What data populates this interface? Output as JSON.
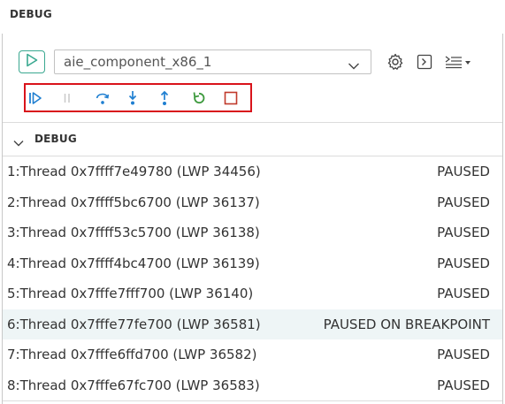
{
  "view": {
    "title": "DEBUG"
  },
  "launch": {
    "config_value": "aie_component_x86_1",
    "run_icon": "play-icon",
    "chevron_icon": "chevron-down-icon",
    "settings_icon": "gear-icon",
    "console_icon": "terminal-icon",
    "more_icon": "list-dropdown-icon"
  },
  "debug_toolbar": {
    "buttons": [
      {
        "name": "continue-icon",
        "enabled": true
      },
      {
        "name": "pause-icon",
        "enabled": false
      },
      {
        "name": "step-over-icon",
        "enabled": true
      },
      {
        "name": "step-into-icon",
        "enabled": true
      },
      {
        "name": "step-out-icon",
        "enabled": true
      },
      {
        "name": "restart-icon",
        "enabled": true
      },
      {
        "name": "stop-icon",
        "enabled": true
      }
    ],
    "highlight_color": "#d9131b"
  },
  "section": {
    "title": "DEBUG"
  },
  "threads": [
    {
      "name": "1:Thread 0x7ffff7e49780 (LWP 34456)",
      "status": "PAUSED"
    },
    {
      "name": "2:Thread 0x7ffff5bc6700 (LWP 36137)",
      "status": "PAUSED"
    },
    {
      "name": "3:Thread 0x7ffff53c5700 (LWP 36138)",
      "status": "PAUSED"
    },
    {
      "name": "4:Thread 0x7ffff4bc4700 (LWP 36139)",
      "status": "PAUSED"
    },
    {
      "name": "5:Thread 0x7fffe7fff700 (LWP 36140)",
      "status": "PAUSED"
    },
    {
      "name": "6:Thread 0x7fffe77fe700 (LWP 36581)",
      "status": "PAUSED ON BREAKPOINT"
    },
    {
      "name": "7:Thread 0x7fffe6ffd700 (LWP 36582)",
      "status": "PAUSED"
    },
    {
      "name": "8:Thread 0x7fffe67fc700 (LWP 36583)",
      "status": "PAUSED"
    }
  ],
  "colors": {
    "accent_blue": "#1f7fd1",
    "restart_green": "#3e9a3e",
    "stop_red": "#c0392b",
    "run_border": "#3aa890",
    "selected_row": "#eef5f6"
  }
}
